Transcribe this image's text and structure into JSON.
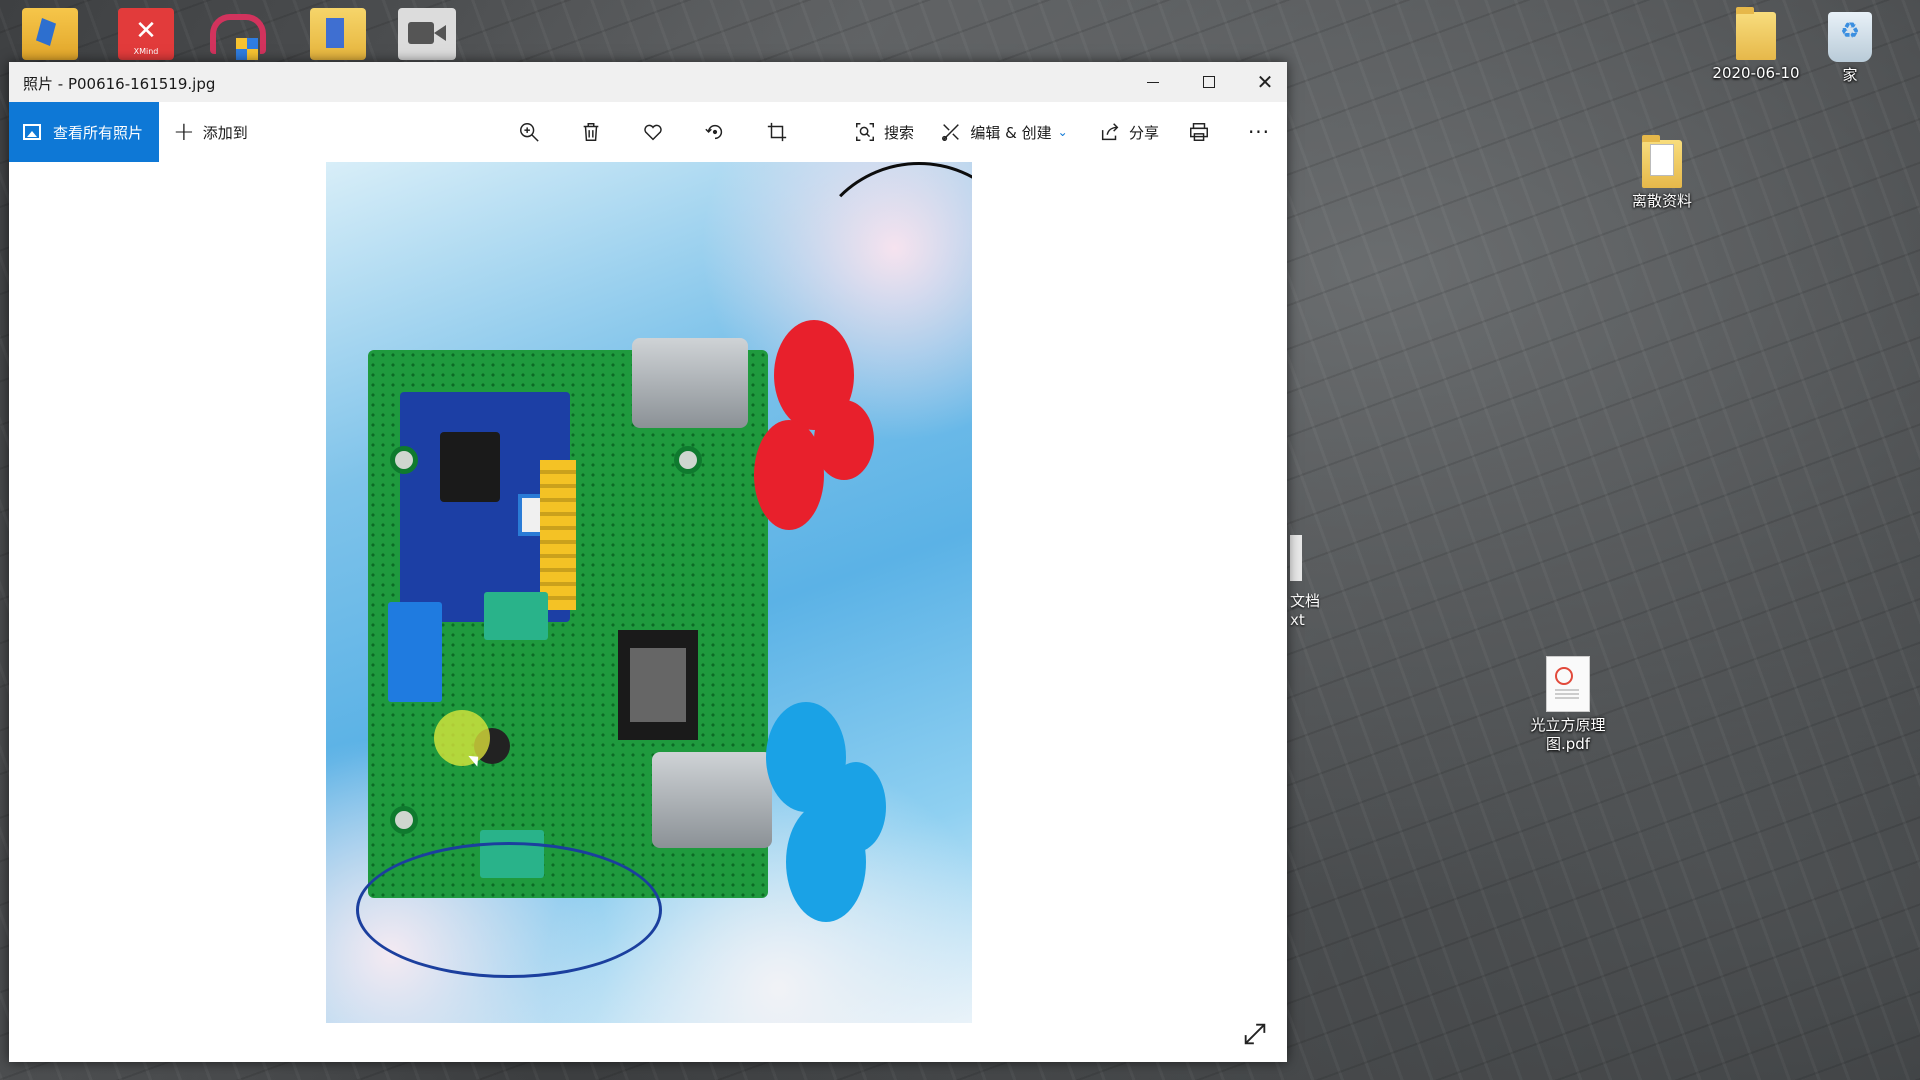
{
  "window": {
    "title": "照片 - P00616-161519.jpg"
  },
  "toolbar": {
    "view_all_label": "查看所有照片",
    "add_to_label": "添加到",
    "search_label": "搜索",
    "edit_label": "编辑 & 创建",
    "share_label": "分享",
    "more_label": "···"
  },
  "desktop": {
    "icons": [
      {
        "label": "2020-06-10",
        "type": "folder"
      },
      {
        "label": "家",
        "type": "recycle-bin"
      },
      {
        "label": "离散资料",
        "type": "folder"
      },
      {
        "label": "光立方原理图.pdf",
        "type": "pdf"
      }
    ],
    "partial_label_1": "文档",
    "partial_label_2": "xt",
    "top_icons": [
      "folder-icon",
      "xmind-icon",
      "app-icon",
      "folder-icon",
      "camera-icon"
    ],
    "top_icon_text": "XMind"
  },
  "colors": {
    "accent": "#0e78d6",
    "titlebar": "#f0f0f0"
  }
}
